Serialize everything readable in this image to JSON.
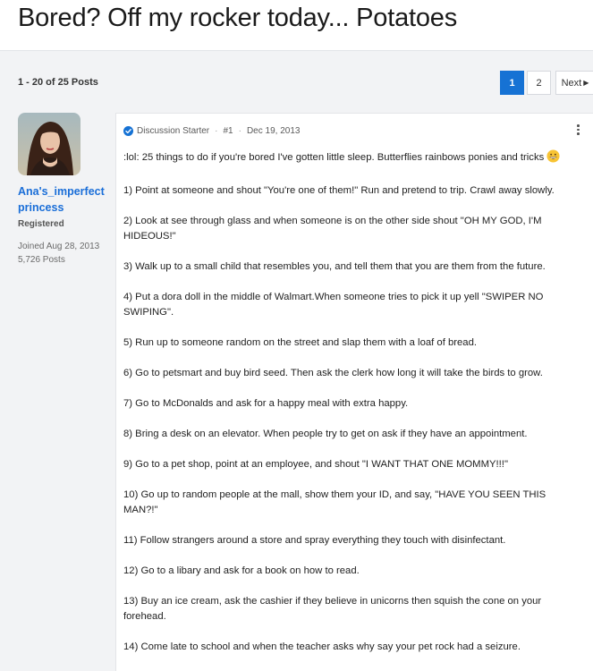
{
  "thread": {
    "title": "Bored? Off my rocker today... Potatoes"
  },
  "pagination": {
    "summary": "1 - 20 of 25 Posts",
    "pages": [
      "1",
      "2"
    ],
    "next_label": "Next"
  },
  "author": {
    "name": "Ana's_imperfect princess",
    "role": "Registered",
    "joined": "Joined Aug 28, 2013",
    "posts": "5,726 Posts"
  },
  "post": {
    "badge": "Discussion Starter",
    "number": "#1",
    "date": "Dec 19, 2013",
    "intro": ":lol: 25 things to do if you're bored I've gotten little sleep. Butterflies rainbows ponies and tricks",
    "items": [
      "1) Point at someone and shout \"You're one of them!\" Run and pretend to trip. Crawl away slowly.",
      "2) Look at see through glass and when someone is on the other side shout \"OH MY GOD, I'M HIDEOUS!\"",
      "3) Walk up to a small child that resembles you, and tell them that you are them from the future.",
      "4) Put a dora doll in the middle of Walmart.When someone tries to pick it up yell \"SWIPER NO SWIPING\".",
      "5) Run up to someone random on the street and slap them with a loaf of bread.",
      "6) Go to petsmart and buy bird seed. Then ask the clerk how long it will take the birds to grow.",
      "7) Go to McDonalds and ask for a happy meal with extra happy.",
      "8) Bring a desk on an elevator. When people try to get on ask if they have an appointment.",
      "9) Go to a pet shop, point at an employee, and shout \"I WANT THAT ONE MOMMY!!!\"",
      "10) Go up to random people at the mall, show them your ID, and say, \"HAVE YOU SEEN THIS MAN?!\"",
      "11) Follow strangers around a store and spray everything they touch with disinfectant.",
      "12) Go to a libary and ask for a book on how to read.",
      "13) Buy an ice cream, ask the cashier if they believe in unicorns then squish the cone on your forehead.",
      "14) Come late to school and when the teacher asks why say your pet rock had a seizure."
    ]
  },
  "colors": {
    "accent": "#1672d4",
    "link": "#1a6ed8"
  }
}
